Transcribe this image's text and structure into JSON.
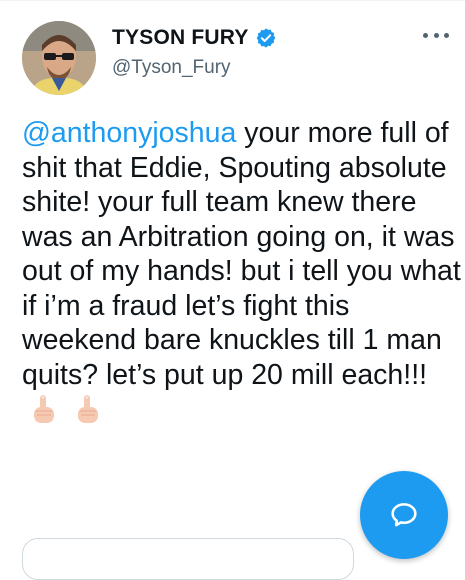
{
  "tweet": {
    "author": {
      "name": "TYSON FURY",
      "handle": "@Tyson_Fury",
      "verified": true
    },
    "mention": "@anthonyjoshua",
    "text": " your more full of shit that Eddie, Spouting absolute shite! your full team knew there was an Arbitration going on, it was out of my hands! but i tell you what if i’m a fraud let’s fight this weekend bare knuckles till 1 man quits? let’s put up 20 mill each!!!",
    "emoji": [
      "middle-finger-emoji",
      "middle-finger-emoji"
    ]
  },
  "colors": {
    "accent": "#1d9bf0",
    "secondary_text": "#536471",
    "primary_text": "#0f1419"
  },
  "icons": {
    "verified": "verified-badge-icon",
    "more": "more-options-icon",
    "fab": "speech-bubble-icon"
  }
}
